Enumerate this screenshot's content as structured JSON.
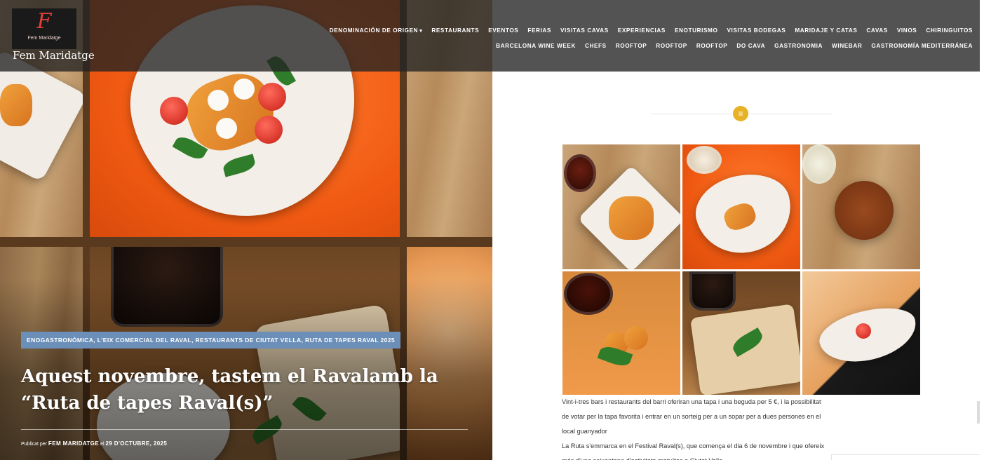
{
  "site": {
    "logo_letter": "F",
    "logo_small": "Fem Maridatge",
    "name": "Fem Maridatge"
  },
  "nav": {
    "row1": [
      {
        "label": "DENOMINACIÓN DE ORIGEN",
        "dropdown": true
      },
      {
        "label": "RESTAURANTS"
      },
      {
        "label": "EVENTOS"
      },
      {
        "label": "FERIAS"
      },
      {
        "label": "VISITAS CAVAS"
      },
      {
        "label": "EXPERIENCIAS"
      },
      {
        "label": "ENOTURISMO"
      },
      {
        "label": "VISITAS BODEGAS"
      },
      {
        "label": "MARIDAJE Y CATAS"
      },
      {
        "label": "CAVAS"
      },
      {
        "label": "VINOS"
      },
      {
        "label": "CHIRINGUITOS"
      }
    ],
    "row2": [
      {
        "label": "BARCELONA WINE WEEK"
      },
      {
        "label": "CHEFS"
      },
      {
        "label": "ROOFTOP"
      },
      {
        "label": "ROOFTOP"
      },
      {
        "label": "ROOFTOP"
      },
      {
        "label": "DO CAVA"
      },
      {
        "label": "GASTRONOMIA"
      },
      {
        "label": "WINEBAR"
      },
      {
        "label": "GASTRONOMÍA MEDITERRÁNEA"
      }
    ],
    "dropdown_icon": "chevron-down-icon"
  },
  "hero": {
    "categories": "ENOGASTRONÒMICA, L'EIX COMERCIAL DEL RAVAL, RESTAURANTS DE CIUTAT VELLA, RUTA DE TAPES RAVAL 2025",
    "title": "Aquest novembre, tastem el Ravalamb la “Ruta de tapes Raval(s)”",
    "byline_prefix": "Publicat per",
    "author": "FEM MARIDATGE",
    "byline_mid": "el",
    "date": "29 D'OCTUBRE, 2025"
  },
  "separator": {
    "icon": "menu-lines-icon",
    "glyph": "≡",
    "color": "#e7b226"
  },
  "article": {
    "paragraphs": [
      "Vint-i-tres bars i restaurants del barri oferiran una tapa i una beguda per 5 €, i la possibilitat de votar per la tapa favorita i entrar en un sorteig per a un sopar per a dues persones en el local guanyador",
      "La Ruta s'emmarca en el Festival Raval(s), que comença el dia 6 de novembre i que ofereix més d'una seixantena d'activitats gratuïtes a Ciutat Vella"
    ]
  },
  "colors": {
    "header_bg": "#222222",
    "category_badge": "#6b8fb8",
    "accent": "#e7b226",
    "logo_red": "#e2403a"
  }
}
